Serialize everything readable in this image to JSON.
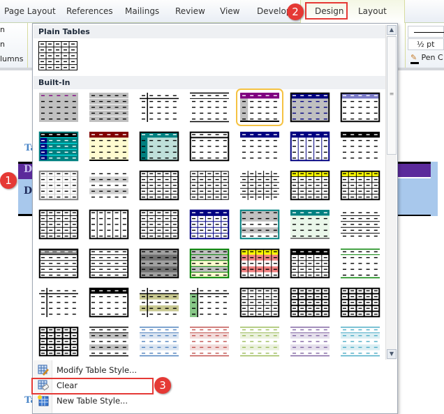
{
  "tabs": [
    "Page Layout",
    "References",
    "Mailings",
    "Review",
    "View",
    "Develop",
    "Design",
    "Layout"
  ],
  "callouts": [
    "1",
    "2",
    "3"
  ],
  "ribbon": {
    "left_items": [
      "n",
      "n",
      "lumns"
    ],
    "pen_weight": "½ pt",
    "pen_color": "Pen C"
  },
  "document": {
    "heading_fragment": "Ta",
    "cell_fragment": "D",
    "header_color": "#5b2a9b",
    "body_color": "#a8c8ec"
  },
  "gallery": {
    "plain_tables_label": "Plain Tables",
    "builtin_label": "Built-In",
    "selected_index": 4,
    "styles": [
      {
        "g": "none",
        "b": "#c0c0c0",
        "hd": "#800080"
      },
      {
        "g": "rows",
        "b": "#c0c0c0",
        "gl": "#fff"
      },
      {
        "g": "cross",
        "b": "#fff"
      },
      {
        "g": "tb",
        "b": "#fff",
        "gl": "#000"
      },
      {
        "g": "none",
        "h": "#800080",
        "b": "#fff",
        "lc": "#c0c0c0",
        "bot": "#000"
      },
      {
        "g": "none",
        "h": "#000080",
        "b": "#c0c0c0",
        "k": "#000",
        "dd": "#000080"
      },
      {
        "g": "none",
        "h": "#7a7ac8",
        "b": "#fff",
        "k": "#000"
      },
      {
        "g": "rows",
        "h": "#000",
        "b": "#008080",
        "k": "#008080",
        "gl": "#00ffff",
        "lc": "#000080",
        "dd": "#fff"
      },
      {
        "g": "none",
        "h": "#800000",
        "b": "#fffbd0",
        "bot": "#000"
      },
      {
        "g": "none",
        "h": "#008080",
        "b": "#bfe0da",
        "k": "#000",
        "lc": "#008080"
      },
      {
        "g": "hline",
        "h": "#fff",
        "b": "#fff",
        "k": "#000"
      },
      {
        "g": "none",
        "h": "#000080",
        "b": "#fff"
      },
      {
        "g": "cols",
        "h": "#000080",
        "b": "#fff",
        "k": "#000080",
        "gl": "#000080"
      },
      {
        "g": "none",
        "h": "#000",
        "b": "#fff"
      },
      {
        "g": "all",
        "b": "#fff",
        "k": "#808080",
        "gl": "#ccc"
      },
      {
        "g": "none",
        "b": "#fff",
        "band": "#d0d0d0"
      },
      {
        "g": "all",
        "b": "#fff",
        "k": "#000",
        "gl": "#000"
      },
      {
        "g": "all",
        "b": "#fff",
        "k": "#000",
        "gl": "#000",
        "thin": true
      },
      {
        "g": "grid",
        "b": "#fff",
        "gl": "#000"
      },
      {
        "g": "all",
        "h": "#ffff00",
        "b": "#fff",
        "k": "#000",
        "gl": "#000"
      },
      {
        "g": "all",
        "h": "#ffff00",
        "b": "#fff",
        "k": "#000",
        "gl": "#000"
      },
      {
        "g": "all",
        "b": "#fff",
        "k": "#000",
        "gl": "#000"
      },
      {
        "g": "cols",
        "b": "#fff",
        "k": "#000",
        "gl": "#000"
      },
      {
        "g": "all",
        "b": "#fff",
        "k": "#000",
        "gl": "#000"
      },
      {
        "g": "all",
        "h": "#000080",
        "b": "#fff",
        "k": "#000080",
        "gl": "#000080"
      },
      {
        "g": "none",
        "h": "#c0c0c0",
        "b": "#fff",
        "k": "#008080",
        "band": "#c0c0c0"
      },
      {
        "g": "none",
        "h": "#008080",
        "b": "#eaf7ea",
        "bot": "#808080"
      },
      {
        "g": "rows",
        "b": "#fff",
        "gl": "#000"
      },
      {
        "g": "rows",
        "h": "#808080",
        "b": "#fff",
        "k": "#000",
        "gl": "#000"
      },
      {
        "g": "rows",
        "b": "#fff",
        "k": "#000",
        "gl": "#000"
      },
      {
        "g": "none",
        "b": "#a0a0a0",
        "k": "#000",
        "band": "#707070"
      },
      {
        "g": "rows",
        "h": "#c0c0c0",
        "b": "#fffbd0",
        "k": "#008000",
        "band": "#c0c0c0",
        "gl": "#008000"
      },
      {
        "g": "cols",
        "h": "#ffff00",
        "b": "#fff",
        "k": "#000",
        "band": "#f08080",
        "gl": "#000"
      },
      {
        "g": "all",
        "h": "#000",
        "b": "#fff",
        "k": "#000",
        "gl": "#000"
      },
      {
        "g": "tb",
        "b": "#fff",
        "gl": "#008000"
      },
      {
        "g": "cross",
        "b": "#fff"
      },
      {
        "g": "none",
        "h": "#000",
        "b": "#fff",
        "k": "#000"
      },
      {
        "g": "cross",
        "b": "#fff",
        "band": "#c8c890"
      },
      {
        "g": "cross",
        "b": "#fff",
        "lc": "#88c888"
      },
      {
        "g": "all",
        "b": "#fff",
        "k": "#000",
        "gl": "#000"
      },
      {
        "g": "all",
        "b": "#fff",
        "k": "#000",
        "gl": "#000",
        "thick": true
      },
      {
        "g": "all",
        "b": "#fff",
        "k": "#000",
        "gl": "#000",
        "thick": true
      },
      {
        "g": "all",
        "b": "#fff",
        "k": "#000",
        "gl": "#000",
        "thick": true
      },
      {
        "g": "tb",
        "b": "#fff",
        "band": "#c0c0c0",
        "gl": "#000"
      },
      {
        "g": "tb",
        "b": "#fff",
        "band": "#dbe5f1",
        "gl": "#4f81bd",
        "dd": "#4f81bd"
      },
      {
        "g": "tb",
        "b": "#fff",
        "band": "#f2dcdb",
        "gl": "#c0504d",
        "dd": "#c0504d"
      },
      {
        "g": "tb",
        "b": "#fff",
        "band": "#ebf1de",
        "gl": "#9bbb59",
        "dd": "#9bbb59"
      },
      {
        "g": "tb",
        "b": "#fff",
        "band": "#e5e0ec",
        "gl": "#8064a2",
        "dd": "#8064a2"
      },
      {
        "g": "tb",
        "b": "#fff",
        "band": "#dbeef3",
        "gl": "#4bacc6",
        "dd": "#4bacc6"
      }
    ]
  },
  "menu": {
    "modify": "Modify Table Style...",
    "clear": "Clear",
    "new": "New Table Style..."
  }
}
